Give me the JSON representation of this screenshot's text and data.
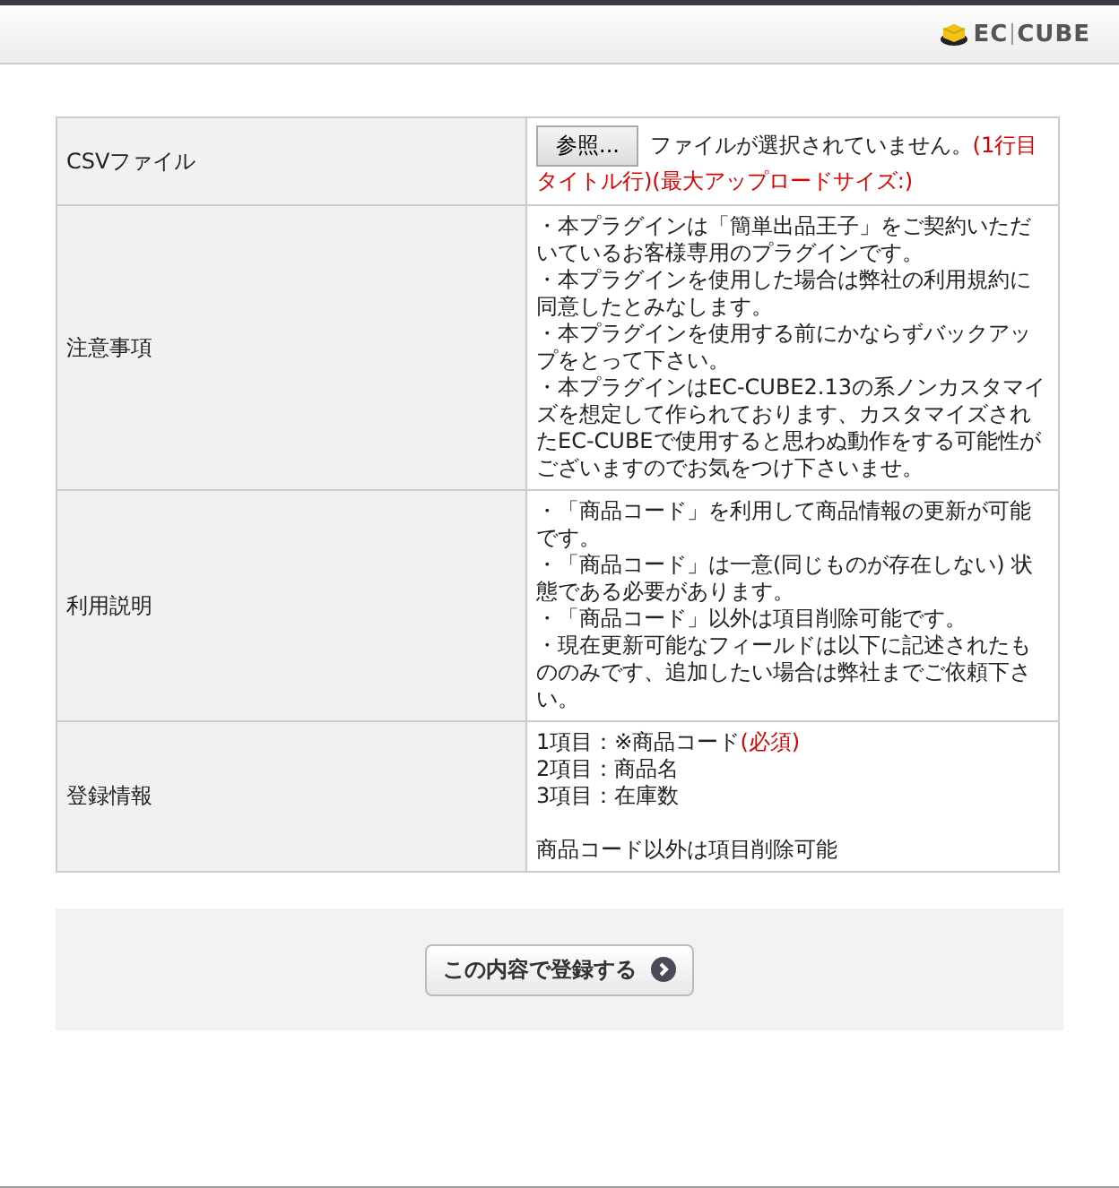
{
  "header": {
    "logo_parts": [
      "EC",
      "CUBE"
    ]
  },
  "rows": [
    {
      "kind": "file",
      "label": "CSVファイル",
      "button": "参照...",
      "status": "ファイルが選択されていません。",
      "note": "(1行目タイトル行)(最大アップロードサイズ:)"
    },
    {
      "kind": "lines",
      "label": "注意事項",
      "lines": [
        "・本プラグインは「簡単出品王子」をご契約いただいているお客様専用のプラグインです。",
        "・本プラグインを使用した場合は弊社の利用規約に同意したとみなします。",
        "・本プラグインを使用する前にかならずバックアップをとって下さい。",
        "・本プラグインはEC-CUBE2.13の系ノンカスタマイズを想定して作られております、カスタマイズされたEC-CUBEで使用すると思わぬ動作をする可能性がございますのでお気をつけ下さいませ。"
      ]
    },
    {
      "kind": "lines",
      "label": "利用説明",
      "lines": [
        "・「商品コード」を利用して商品情報の更新が可能です。",
        "・「商品コード」は一意(同じものが存在しない) 状態である必要があります。",
        "・「商品コード」以外は項目削除可能です。",
        "・現在更新可能なフィールドは以下に記述されたもののみです、追加したい場合は弊社までご依頼下さい。"
      ]
    },
    {
      "kind": "fields",
      "label": "登録情報",
      "fields": [
        {
          "text": "1項目：※商品コード",
          "note": "(必須)"
        },
        {
          "text": "2項目：商品名"
        },
        {
          "text": "3項目：在庫数"
        }
      ],
      "footer": "商品コード以外は項目削除可能"
    }
  ],
  "submit": {
    "label": "この内容で登録する"
  }
}
